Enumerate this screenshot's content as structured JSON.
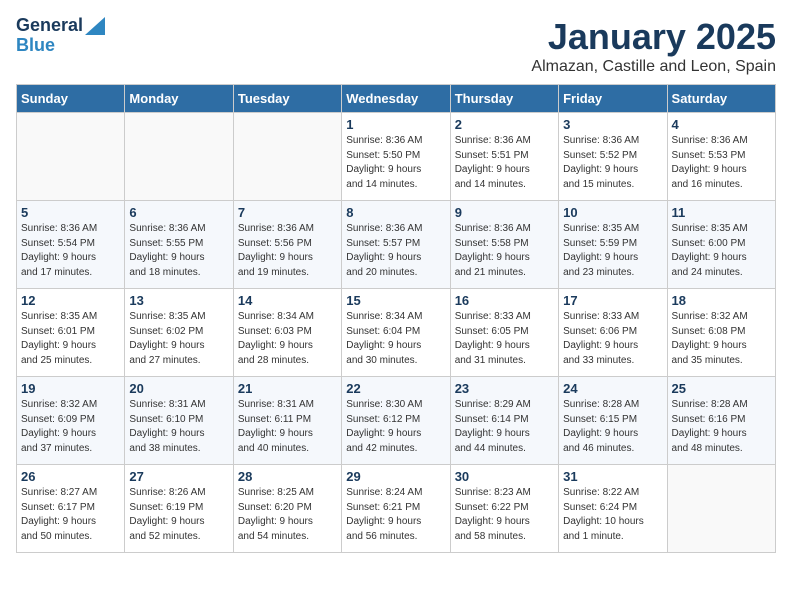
{
  "logo": {
    "line1": "General",
    "line2": "Blue"
  },
  "title": "January 2025",
  "subtitle": "Almazan, Castille and Leon, Spain",
  "headers": [
    "Sunday",
    "Monday",
    "Tuesday",
    "Wednesday",
    "Thursday",
    "Friday",
    "Saturday"
  ],
  "weeks": [
    [
      {
        "day": "",
        "info": ""
      },
      {
        "day": "",
        "info": ""
      },
      {
        "day": "",
        "info": ""
      },
      {
        "day": "1",
        "info": "Sunrise: 8:36 AM\nSunset: 5:50 PM\nDaylight: 9 hours\nand 14 minutes."
      },
      {
        "day": "2",
        "info": "Sunrise: 8:36 AM\nSunset: 5:51 PM\nDaylight: 9 hours\nand 14 minutes."
      },
      {
        "day": "3",
        "info": "Sunrise: 8:36 AM\nSunset: 5:52 PM\nDaylight: 9 hours\nand 15 minutes."
      },
      {
        "day": "4",
        "info": "Sunrise: 8:36 AM\nSunset: 5:53 PM\nDaylight: 9 hours\nand 16 minutes."
      }
    ],
    [
      {
        "day": "5",
        "info": "Sunrise: 8:36 AM\nSunset: 5:54 PM\nDaylight: 9 hours\nand 17 minutes."
      },
      {
        "day": "6",
        "info": "Sunrise: 8:36 AM\nSunset: 5:55 PM\nDaylight: 9 hours\nand 18 minutes."
      },
      {
        "day": "7",
        "info": "Sunrise: 8:36 AM\nSunset: 5:56 PM\nDaylight: 9 hours\nand 19 minutes."
      },
      {
        "day": "8",
        "info": "Sunrise: 8:36 AM\nSunset: 5:57 PM\nDaylight: 9 hours\nand 20 minutes."
      },
      {
        "day": "9",
        "info": "Sunrise: 8:36 AM\nSunset: 5:58 PM\nDaylight: 9 hours\nand 21 minutes."
      },
      {
        "day": "10",
        "info": "Sunrise: 8:35 AM\nSunset: 5:59 PM\nDaylight: 9 hours\nand 23 minutes."
      },
      {
        "day": "11",
        "info": "Sunrise: 8:35 AM\nSunset: 6:00 PM\nDaylight: 9 hours\nand 24 minutes."
      }
    ],
    [
      {
        "day": "12",
        "info": "Sunrise: 8:35 AM\nSunset: 6:01 PM\nDaylight: 9 hours\nand 25 minutes."
      },
      {
        "day": "13",
        "info": "Sunrise: 8:35 AM\nSunset: 6:02 PM\nDaylight: 9 hours\nand 27 minutes."
      },
      {
        "day": "14",
        "info": "Sunrise: 8:34 AM\nSunset: 6:03 PM\nDaylight: 9 hours\nand 28 minutes."
      },
      {
        "day": "15",
        "info": "Sunrise: 8:34 AM\nSunset: 6:04 PM\nDaylight: 9 hours\nand 30 minutes."
      },
      {
        "day": "16",
        "info": "Sunrise: 8:33 AM\nSunset: 6:05 PM\nDaylight: 9 hours\nand 31 minutes."
      },
      {
        "day": "17",
        "info": "Sunrise: 8:33 AM\nSunset: 6:06 PM\nDaylight: 9 hours\nand 33 minutes."
      },
      {
        "day": "18",
        "info": "Sunrise: 8:32 AM\nSunset: 6:08 PM\nDaylight: 9 hours\nand 35 minutes."
      }
    ],
    [
      {
        "day": "19",
        "info": "Sunrise: 8:32 AM\nSunset: 6:09 PM\nDaylight: 9 hours\nand 37 minutes."
      },
      {
        "day": "20",
        "info": "Sunrise: 8:31 AM\nSunset: 6:10 PM\nDaylight: 9 hours\nand 38 minutes."
      },
      {
        "day": "21",
        "info": "Sunrise: 8:31 AM\nSunset: 6:11 PM\nDaylight: 9 hours\nand 40 minutes."
      },
      {
        "day": "22",
        "info": "Sunrise: 8:30 AM\nSunset: 6:12 PM\nDaylight: 9 hours\nand 42 minutes."
      },
      {
        "day": "23",
        "info": "Sunrise: 8:29 AM\nSunset: 6:14 PM\nDaylight: 9 hours\nand 44 minutes."
      },
      {
        "day": "24",
        "info": "Sunrise: 8:28 AM\nSunset: 6:15 PM\nDaylight: 9 hours\nand 46 minutes."
      },
      {
        "day": "25",
        "info": "Sunrise: 8:28 AM\nSunset: 6:16 PM\nDaylight: 9 hours\nand 48 minutes."
      }
    ],
    [
      {
        "day": "26",
        "info": "Sunrise: 8:27 AM\nSunset: 6:17 PM\nDaylight: 9 hours\nand 50 minutes."
      },
      {
        "day": "27",
        "info": "Sunrise: 8:26 AM\nSunset: 6:19 PM\nDaylight: 9 hours\nand 52 minutes."
      },
      {
        "day": "28",
        "info": "Sunrise: 8:25 AM\nSunset: 6:20 PM\nDaylight: 9 hours\nand 54 minutes."
      },
      {
        "day": "29",
        "info": "Sunrise: 8:24 AM\nSunset: 6:21 PM\nDaylight: 9 hours\nand 56 minutes."
      },
      {
        "day": "30",
        "info": "Sunrise: 8:23 AM\nSunset: 6:22 PM\nDaylight: 9 hours\nand 58 minutes."
      },
      {
        "day": "31",
        "info": "Sunrise: 8:22 AM\nSunset: 6:24 PM\nDaylight: 10 hours\nand 1 minute."
      },
      {
        "day": "",
        "info": ""
      }
    ]
  ]
}
